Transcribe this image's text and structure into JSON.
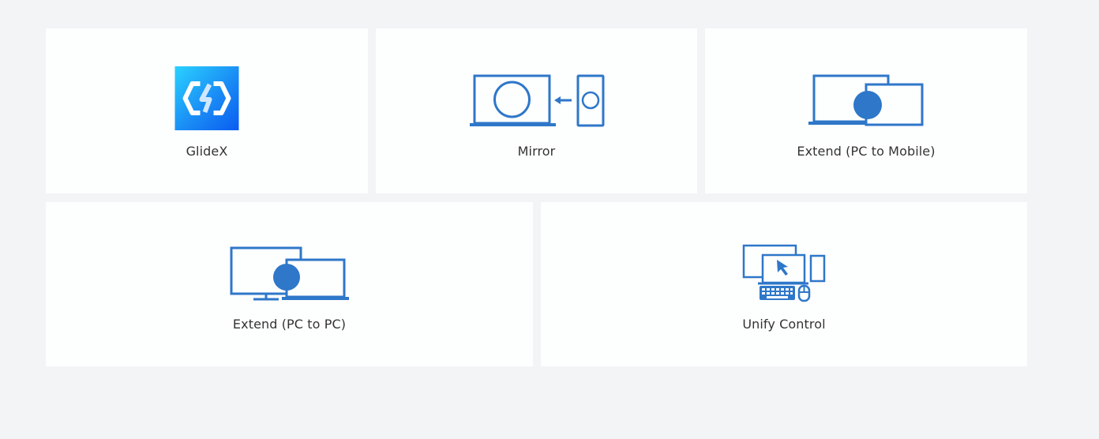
{
  "accent_color": "#2e77c9",
  "tiles": [
    {
      "label": "GlideX",
      "icon": "glidex-logo-icon"
    },
    {
      "label": "Mirror",
      "icon": "mirror-icon"
    },
    {
      "label": "Extend (PC to Mobile)",
      "icon": "extend-pc-to-mobile-icon"
    },
    {
      "label": "Extend (PC to PC)",
      "icon": "extend-pc-to-pc-icon"
    },
    {
      "label": "Unify Control",
      "icon": "unify-control-icon"
    }
  ]
}
